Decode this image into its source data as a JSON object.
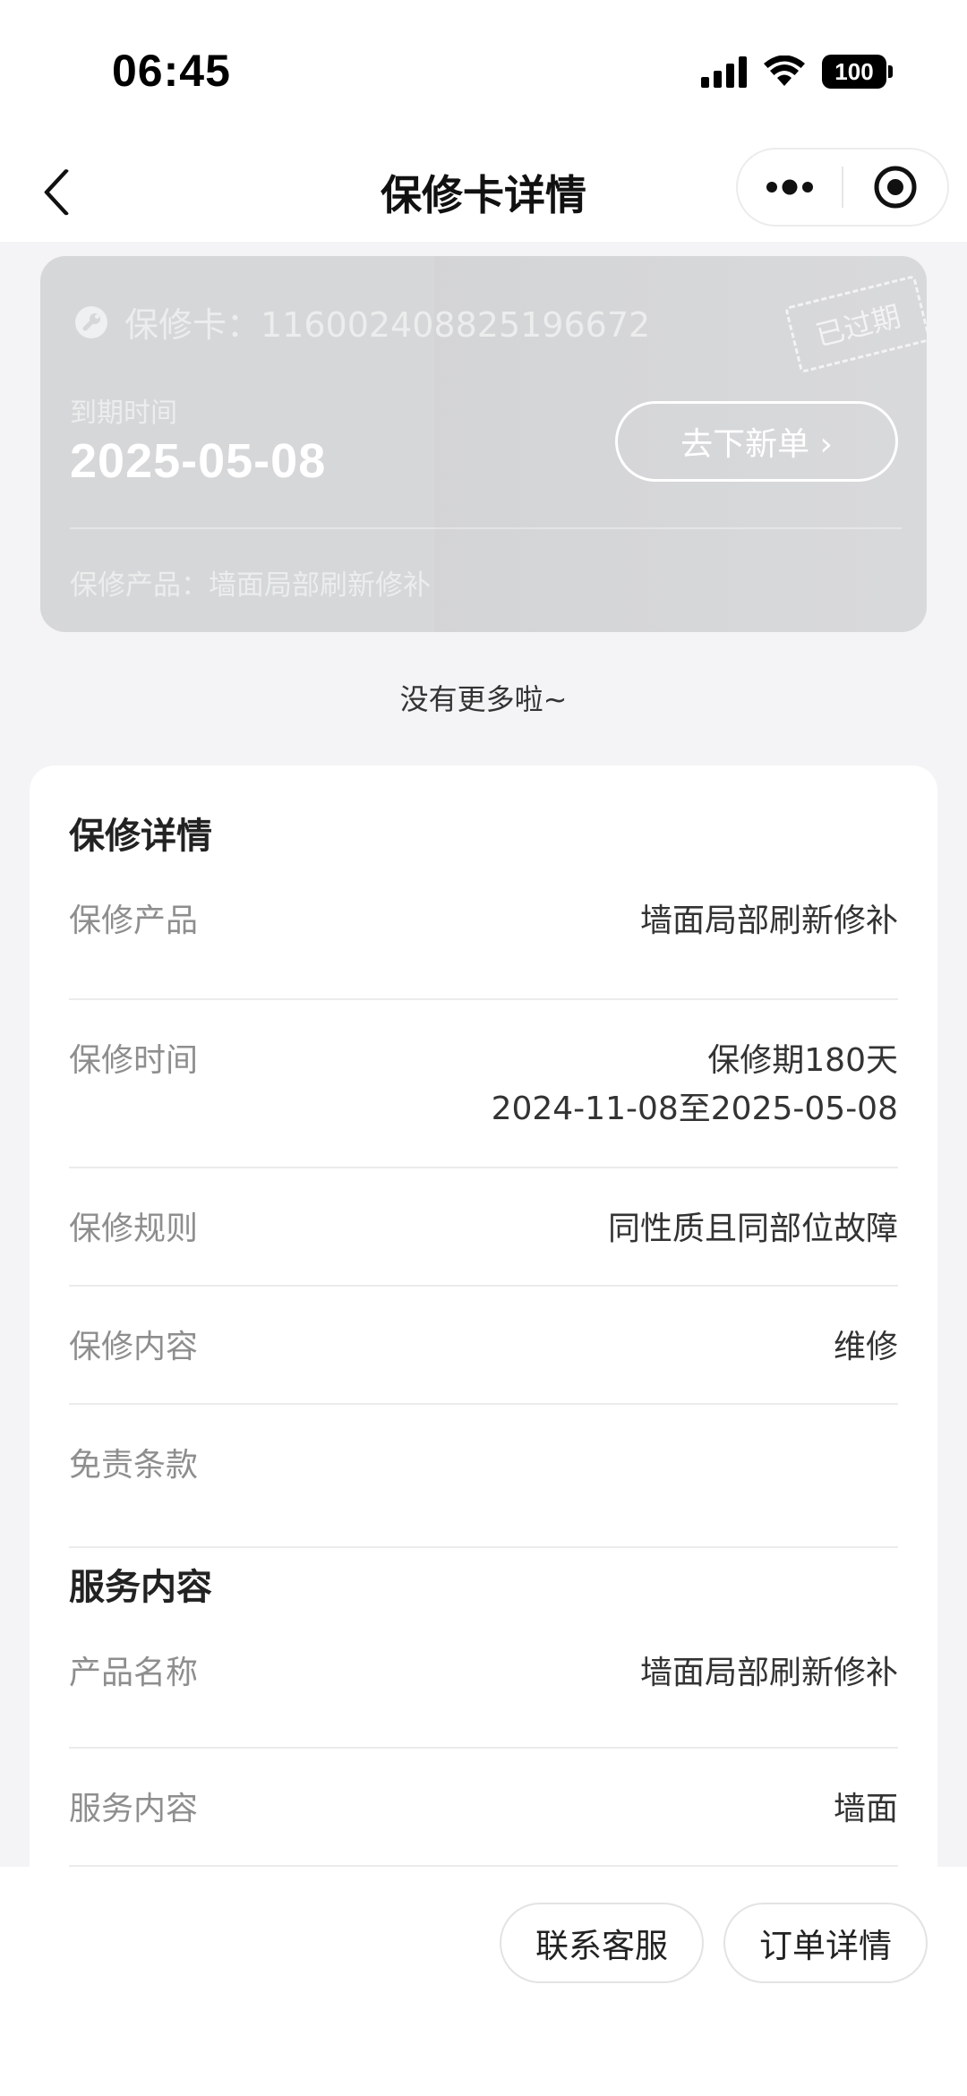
{
  "status_bar": {
    "time": "06:45",
    "battery": "100"
  },
  "nav": {
    "title": "保修卡详情"
  },
  "card": {
    "number_label": "保修卡：116002408825196672",
    "expire_label": "到期时间",
    "expire_date": "2025-05-08",
    "new_order_button": "去下新单 ›",
    "product_line": "保修产品：墙面局部刷新修补",
    "stamp": "已过期"
  },
  "no_more_text": "没有更多啦~",
  "warranty_details": {
    "title": "保修详情",
    "rows": [
      {
        "label": "保修产品",
        "value": "墙面局部刷新修补"
      },
      {
        "label": "保修时间",
        "value": "保修期180天",
        "value2": "2024-11-08至2025-05-08"
      },
      {
        "label": "保修规则",
        "value": "同性质且同部位故障"
      },
      {
        "label": "保修内容",
        "value": "维修"
      },
      {
        "label": "免责条款",
        "value": ""
      }
    ]
  },
  "service_content": {
    "title": "服务内容",
    "rows": [
      {
        "label": "产品名称",
        "value": "墙面局部刷新修补"
      },
      {
        "label": "服务内容",
        "value": "墙面"
      }
    ]
  },
  "bottom": {
    "contact_button": "联系客服",
    "order_button": "订单详情"
  }
}
